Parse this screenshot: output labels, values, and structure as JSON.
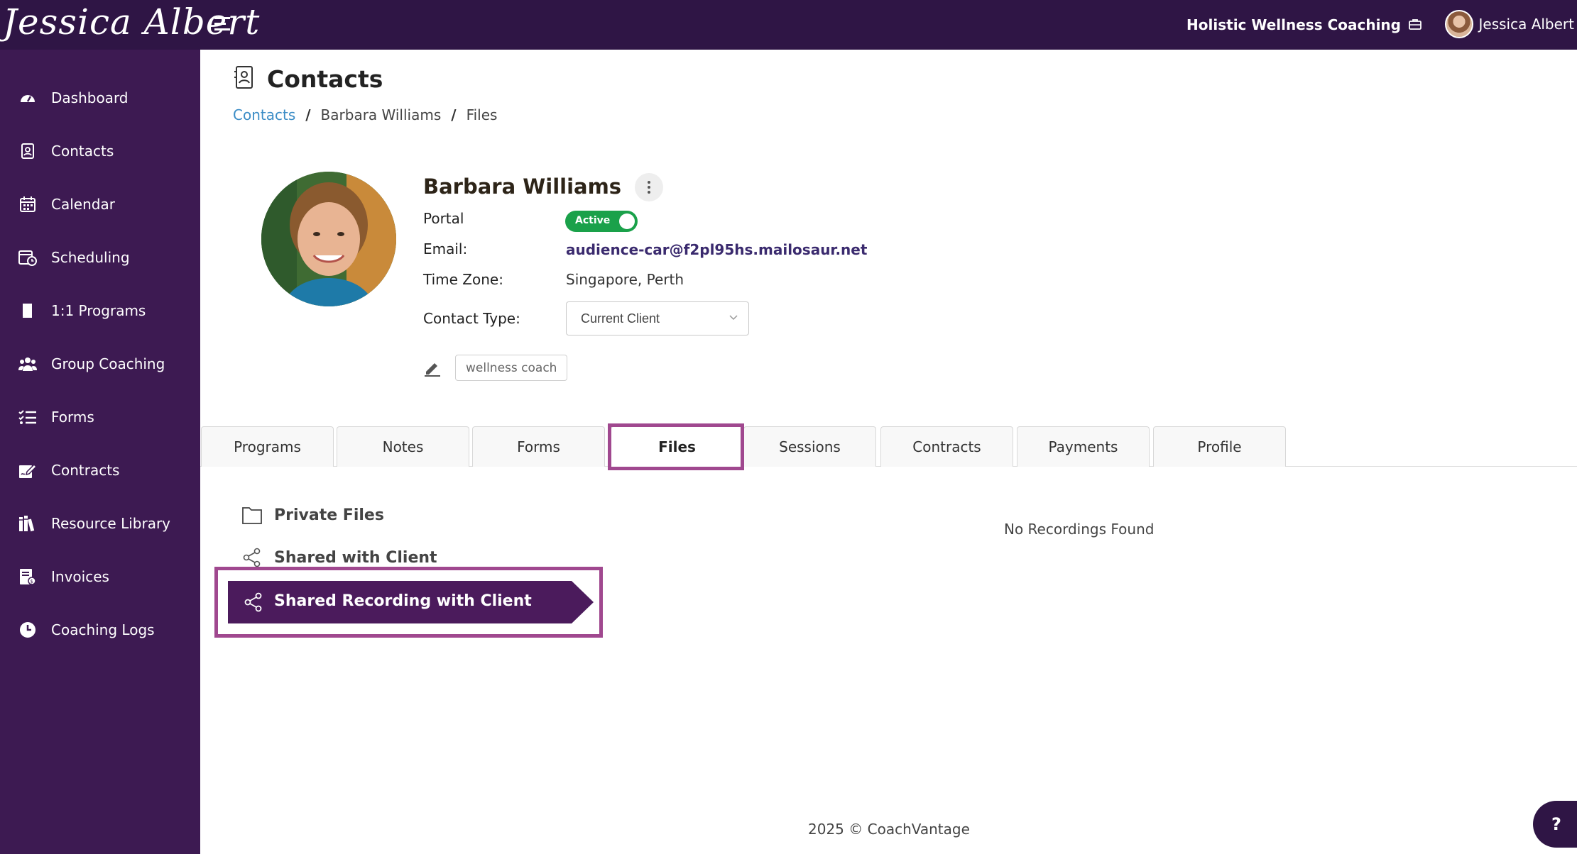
{
  "app": {
    "logo_text": "Jessica Albert",
    "business_name": "Holistic Wellness Coaching",
    "user_name": "Jessica Albert",
    "brand_color": "#2f1545",
    "sidebar_color": "#3d1a52",
    "highlight_color": "#a0488f"
  },
  "sidebar": {
    "items": [
      {
        "label": "Dashboard",
        "icon": "dashboard-icon"
      },
      {
        "label": "Contacts",
        "icon": "contacts-icon"
      },
      {
        "label": "Calendar",
        "icon": "calendar-icon"
      },
      {
        "label": "Scheduling",
        "icon": "scheduling-icon"
      },
      {
        "label": "1:1 Programs",
        "icon": "book-icon"
      },
      {
        "label": "Group Coaching",
        "icon": "group-icon"
      },
      {
        "label": "Forms",
        "icon": "checklist-icon"
      },
      {
        "label": "Contracts",
        "icon": "signature-icon"
      },
      {
        "label": "Resource Library",
        "icon": "library-icon"
      },
      {
        "label": "Invoices",
        "icon": "invoice-icon"
      },
      {
        "label": "Coaching Logs",
        "icon": "clock-icon"
      }
    ]
  },
  "page": {
    "title": "Contacts",
    "breadcrumb": [
      "Contacts",
      "Barbara Williams",
      "Files"
    ]
  },
  "contact": {
    "name": "Barbara Williams",
    "portal_label": "Portal",
    "portal_status": "Active",
    "email_label": "Email:",
    "email": "audience-car@f2pl95hs.mailosaur.net",
    "timezone_label": "Time Zone:",
    "timezone": "Singapore, Perth",
    "type_label": "Contact Type:",
    "type_value": "Current Client",
    "tags": [
      "wellness coach"
    ]
  },
  "tabs": [
    {
      "label": "Programs"
    },
    {
      "label": "Notes"
    },
    {
      "label": "Forms"
    },
    {
      "label": "Files",
      "active": true
    },
    {
      "label": "Sessions"
    },
    {
      "label": "Contracts"
    },
    {
      "label": "Payments"
    },
    {
      "label": "Profile"
    }
  ],
  "files": {
    "sections": [
      "Private Files",
      "Shared with Client",
      "Shared Recording with Client"
    ],
    "selected": "Shared Recording with Client",
    "empty_message": "No Recordings Found"
  },
  "footer": {
    "text": "2025 © CoachVantage",
    "help": "?"
  }
}
